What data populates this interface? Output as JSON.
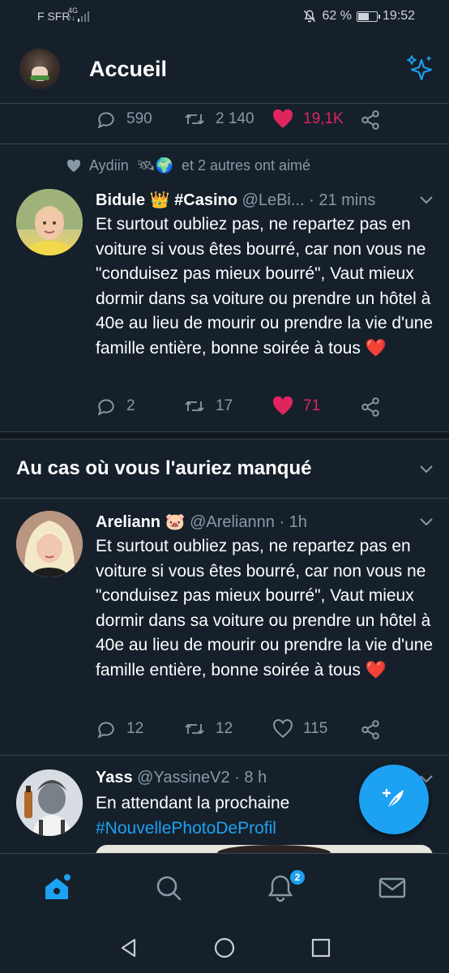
{
  "status_bar": {
    "carrier": "F SFR",
    "network": "4G",
    "network_sub": "↑↓",
    "battery": "62 %",
    "battery_level": 0.62,
    "time": "19:52"
  },
  "header": {
    "title": "Accueil",
    "icons": {
      "avatar": "user-avatar",
      "sparkle": "sparkle-icon"
    }
  },
  "feed": {
    "first_tweet_actions": {
      "replies": "590",
      "retweets": "2 140",
      "likes": "19,1K"
    },
    "liked_tweet": {
      "context": "Aydiin",
      "context_emoji": "🛰🌍",
      "context_rest": "et 2 autres ont aimé",
      "name": "Bidule",
      "name_emoji": "👑",
      "name_tag": "#Casino",
      "handle": "@LeBi...",
      "time": "· 21 mins",
      "text": "Et surtout oubliez pas, ne repartez pas en voiture si vous êtes bourré, car non vous ne \"conduisez pas mieux bourré\", Vaut mieux dormir dans sa voiture ou prendre un hôtel à 40e au lieu de mourir ou prendre la vie d'une famille entière, bonne soirée à tous",
      "text_emoji": "❤️",
      "replies": "2",
      "retweets": "17",
      "likes": "71"
    },
    "section_title": "Au cas où vous l'auriez manqué",
    "missed_tweet": {
      "name": "Areliann",
      "name_emoji": "🐷",
      "handle": "@Areliannn",
      "time": "· 1h",
      "text": "Et surtout oubliez pas, ne repartez pas en voiture si vous êtes bourré, car non vous ne \"conduisez pas mieux bourré\", Vaut mieux dormir dans sa voiture ou prendre un hôtel à 40e au lieu de mourir ou prendre la vie d'une famille entière, bonne soirée à tous",
      "text_emoji": "❤️",
      "replies": "12",
      "retweets": "12",
      "likes": "115"
    },
    "third_tweet": {
      "name": "Yass",
      "handle": "@YassineV2",
      "time": "· 8 h",
      "text": "En attendant la prochaine",
      "hashtag": "#NouvellePhotoDeProfil"
    }
  },
  "bottom_nav": {
    "items": [
      "home-icon",
      "search-icon",
      "notifications-icon",
      "messages-icon"
    ],
    "notifications_badge": "2"
  },
  "colors": {
    "background": "#15202b",
    "accent": "#1da1f2",
    "like": "#e0245e",
    "muted": "#8899a6",
    "divider": "#38444d"
  }
}
